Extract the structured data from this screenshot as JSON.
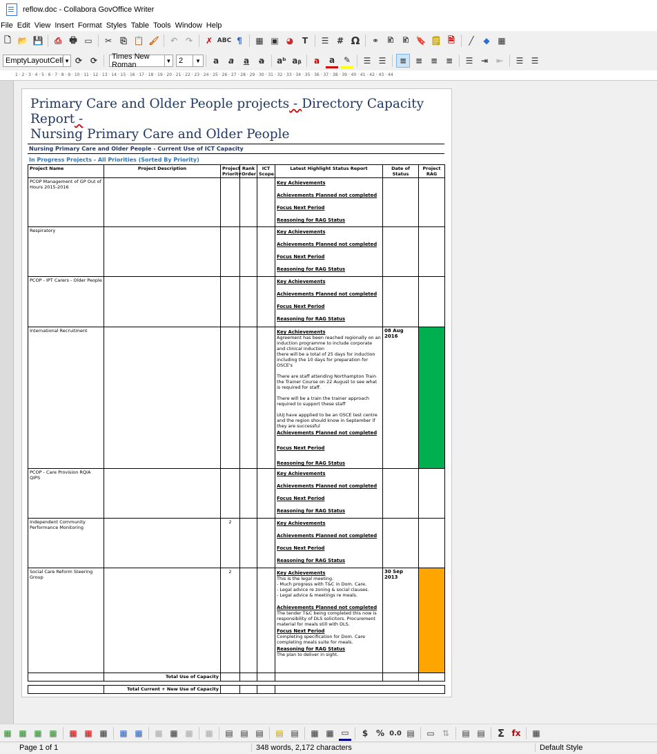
{
  "window": {
    "title": "reflow.doc - Collabora GovOffice Writer"
  },
  "menu": [
    "File",
    "Edit",
    "View",
    "Insert",
    "Format",
    "Styles",
    "Table",
    "Tools",
    "Window",
    "Help"
  ],
  "format_bar": {
    "paragraph_style": "EmptyLayoutCell",
    "font_name": "Times New Roman",
    "font_size": "2"
  },
  "ruler": {
    "marks": "1 · 2 · 3 · 4 · 5 · 6 · 7 · 8 · 9 · 10 · 11 · 12 · 13 · 14 · 15 · 16 · 17 · 18 · 19 · 20 · 21 · 22 · 23 · 24 · 25 · 26 · 27 · 28 · 29 · 30 · 31 · 32 · 33 · 34 · 35 · 36 · 37 · 38 · 39 · 40 · 41 · 42 · 43 · 44"
  },
  "doc": {
    "title_line1_a": "Primary Care and Older People projects",
    "title_line1_b": " - ",
    "title_line1_c": "Directory Capacity Report",
    "title_line1_d": " -",
    "title_line2": "Nursing Primary Care and Older People",
    "subtitle": "Nursing Primary Care and Older People - Current Use of ICT Capacity",
    "section": "In Progress Projects - All Priorities (Sorted By Priority)",
    "headers": {
      "name": "Project Name",
      "desc": "Project Description",
      "priority": "Project Priority",
      "rank": "Rank Order",
      "ict": "ICT Scope",
      "status": "Latest Highlight Status Report",
      "date": "Date of Status",
      "rag": "Project RAG"
    },
    "labels": {
      "key": "Key Achievements",
      "planned": "Achievements Planned not completed",
      "focus": "Focus Next Period",
      "reasoning": "Reasoning for RAG Status"
    },
    "rows": [
      {
        "name": "PCOP Management of GP Out of Hours 2015-2016",
        "priority": "",
        "date": ""
      },
      {
        "name": "Respiratory",
        "priority": "",
        "date": ""
      },
      {
        "name": "PCOP - IPT Carers - Older People",
        "priority": "",
        "date": ""
      },
      {
        "name": "International Recruitment",
        "priority": "",
        "date": "08 Aug 2016",
        "rag": "green",
        "key_text": "Agreement has been reached regionally on an induction programme to include corporate and clinical induction\nthere will be a total of 25 days for induction including the 10 days for preparation for OSCE's\n\nThere are staff attending Northampton Train the Trainer Course on 22 August to see what is required for staff.\n\nThere will be a train the trainer approach required to support these staff\n\nUUJ have appplied to be an OSCE test centre and the region should know in September if they are successful"
      },
      {
        "name": "PCOP - Care Provision RQIA QIPS",
        "priority": "",
        "date": ""
      },
      {
        "name": "Independent Community Performance Monitoring",
        "priority": "2",
        "date": ""
      },
      {
        "name": "Social Care Reform Steering Group",
        "priority": "2",
        "date": "30 Sep 2013",
        "rag": "orange",
        "key_text": "This is the legal meeting.\n- Much progress with T&C in Dom. Care.\n- Legal advice re zoning & social clauses.\n- Legal advice & meetings re meals.",
        "planned_text": "The tender T&C being completed this now is responsibility of DLS solicitors. Procurement material for meals still with DLS.",
        "focus_text": "Completing specification for Dom. Care completing meals suite for meals.",
        "reasoning_text": "The plan to deliver in sight."
      }
    ],
    "total_label": "Total Use of Capacity",
    "total_new_label": "Total Current + New Use of Capacity"
  },
  "status": {
    "page": "Page 1 of 1",
    "words": "348 words, 2,172 characters",
    "style": "Default Style"
  },
  "colors": {
    "rag_green": "#00b050",
    "rag_orange": "#ffa500",
    "title": "#1f3864"
  }
}
